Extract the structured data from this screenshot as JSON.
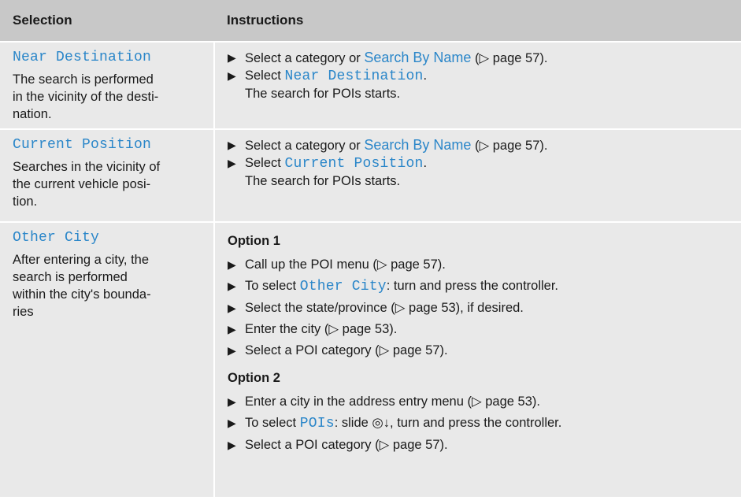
{
  "header": {
    "selection": "Selection",
    "instructions": "Instructions"
  },
  "rows": [
    {
      "name": "Near Destination",
      "desc": "The search is performed in the vicinity of the desti-nation.",
      "steps": [
        {
          "pre": "Select a category or ",
          "cmd": "Search By Name",
          "post": " (▷ page 57)."
        },
        {
          "pre": "Select ",
          "cmd": "Near Destination",
          "post": ".",
          "note": "The search for POIs starts."
        }
      ]
    },
    {
      "name": "Current Position",
      "desc": "Searches in the vicinity of the current vehicle posi-tion.",
      "steps": [
        {
          "pre": "Select a category or ",
          "cmd": "Search By Name",
          "post": " (▷ page 57)."
        },
        {
          "pre": "Select ",
          "cmd": "Current Position",
          "post": ".",
          "note": "The search for POIs starts."
        }
      ]
    },
    {
      "name": "Other City",
      "desc": "After entering a city, the search is performed within the city's bounda-ries",
      "option1": {
        "title": "Option 1",
        "steps": [
          {
            "pre": "Call up the POI menu (▷ page 57).",
            "cmd": "",
            "post": ""
          },
          {
            "pre": "To select ",
            "cmd": "Other City",
            "post": ": turn and press the controller."
          },
          {
            "pre": "Select the state/province (▷ page 53), if desired.",
            "cmd": "",
            "post": ""
          },
          {
            "pre": "Enter the city (▷ page 53).",
            "cmd": "",
            "post": ""
          },
          {
            "pre": "Select a POI category (▷ page 57).",
            "cmd": "",
            "post": ""
          }
        ]
      },
      "option2": {
        "title": "Option 2",
        "steps": [
          {
            "pre": "Enter a city in the address entry menu (▷ page 53).",
            "cmd": "",
            "post": ""
          },
          {
            "pre": "To select ",
            "cmd": "POIs",
            "post": ": slide ◎↓, turn and press the controller."
          },
          {
            "pre": "Select a POI category (▷ page 57).",
            "cmd": "",
            "post": ""
          }
        ]
      }
    }
  ],
  "bullet_glyph": "▶"
}
